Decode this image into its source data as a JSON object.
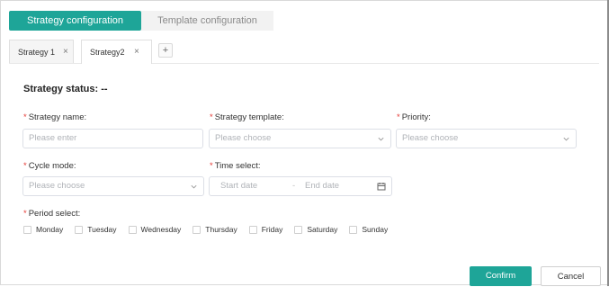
{
  "top_tabs": [
    {
      "label": "Strategy configuration"
    },
    {
      "label": "Template configuration"
    }
  ],
  "strategy_tabs": [
    {
      "label": "Strategy 1",
      "close": "×"
    },
    {
      "label": "Strategy2",
      "close": "×"
    }
  ],
  "add_tab_label": "+",
  "status": {
    "label": "Strategy status:",
    "value": "--"
  },
  "form": {
    "required_mark": "*",
    "strategy_name": {
      "label": "Strategy name:",
      "placeholder": "Please enter"
    },
    "strategy_template": {
      "label": "Strategy template:",
      "placeholder": "Please choose"
    },
    "priority": {
      "label": "Priority:",
      "placeholder": "Please choose"
    },
    "cycle_mode": {
      "label": "Cycle mode:",
      "placeholder": "Please choose"
    },
    "time_select": {
      "label": "Time select:",
      "start_placeholder": "Start date",
      "end_placeholder": "End date"
    },
    "period_select": {
      "label": "Period select:",
      "days": [
        "Monday",
        "Tuesday",
        "Wednesday",
        "Thursday",
        "Friday",
        "Saturday",
        "Sunday"
      ]
    }
  },
  "buttons": {
    "confirm": "Confirm",
    "cancel": "Cancel"
  },
  "colors": {
    "accent": "#1ea598",
    "required": "#e53935"
  }
}
